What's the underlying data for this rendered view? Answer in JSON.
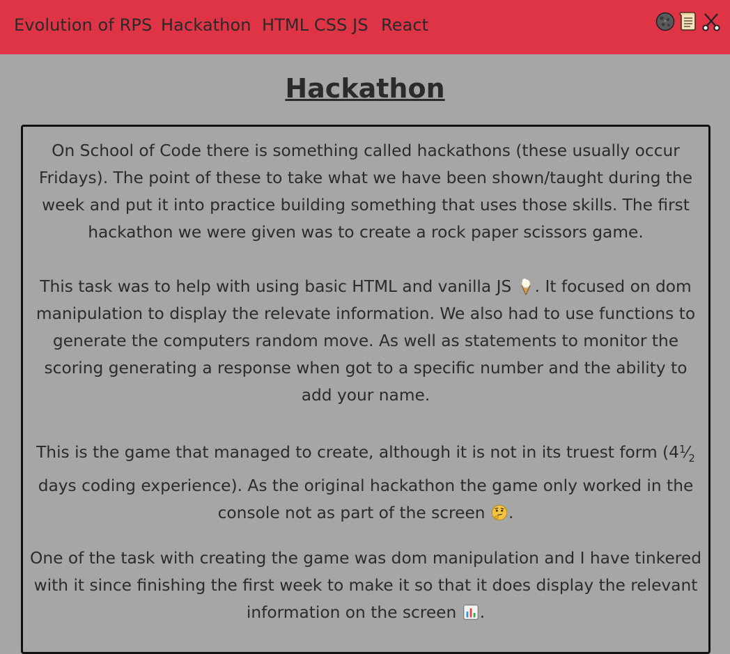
{
  "nav": {
    "links": [
      "Evolution of RPS",
      "Hackathon",
      "HTML CSS JS",
      "React"
    ],
    "icons": [
      "rock-icon",
      "paper-scroll-icon",
      "scissors-icon"
    ]
  },
  "page": {
    "title": "Hackathon"
  },
  "content": {
    "p1": "On School of Code there is something called hackathons (these usually occur Fridays). The point of these to take what we have been shown/taught during the week and put it into practice building something that uses those skills. The first hackathon we were given was to create a rock paper scissors game.",
    "p2_text": "This task was to help with using basic HTML and vanilla JS",
    "p2_rest": ". It focused on dom manipulation to display the relevate information. We also had to use functions to generate the computers random move. As well as statements to monitor the scoring generating a response when got to a specific number and the ability to add your name.",
    "p3_text": "This is the game that managed to create, although it is not in its truest form (4",
    "p3_frac_num": "1",
    "p3_frac_den": "2",
    "p3_rest": " days coding experience). As the original hackathon the game only worked in the console not as part of the screen",
    "p3_end": ".",
    "p4_text": "One of the task with creating the game was dom manipulation and I have tinkered with it since finishing the first week to make it so that it does display the relevant information on the screen",
    "p4_end": "."
  },
  "colors": {
    "navbar": "#de3446",
    "background": "#a6a6a6",
    "text": "#2b2b2b"
  }
}
